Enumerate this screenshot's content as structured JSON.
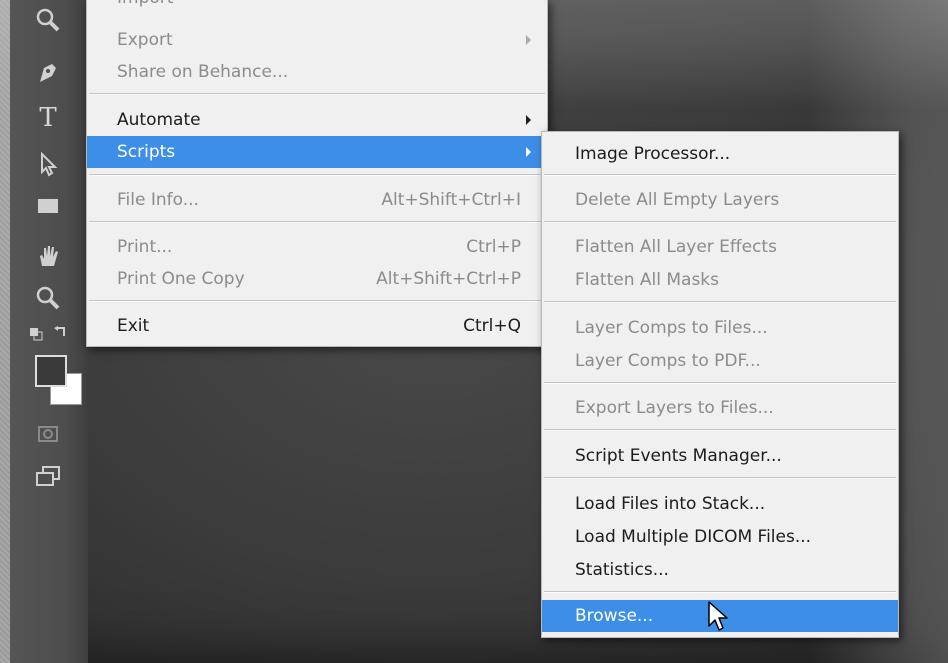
{
  "file_menu": {
    "items": [
      {
        "label": "Import",
        "disabled": true
      },
      {
        "label": "Export",
        "disabled": true
      },
      {
        "label": "Share on Behance...",
        "disabled": true
      },
      {
        "label": "Automate"
      },
      {
        "label": "Scripts",
        "highlighted": true
      },
      {
        "label": "File Info...",
        "shortcut": "Alt+Shift+Ctrl+I",
        "disabled": true
      },
      {
        "label": "Print...",
        "shortcut": "Ctrl+P",
        "disabled": true
      },
      {
        "label": "Print One Copy",
        "shortcut": "Alt+Shift+Ctrl+P",
        "disabled": true
      },
      {
        "label": "Exit",
        "shortcut": "Ctrl+Q"
      }
    ]
  },
  "scripts_menu": {
    "items": [
      {
        "label": "Image Processor..."
      },
      {
        "label": "Delete All Empty Layers",
        "disabled": true
      },
      {
        "label": "Flatten All Layer Effects",
        "disabled": true
      },
      {
        "label": "Flatten All Masks",
        "disabled": true
      },
      {
        "label": "Layer Comps to Files...",
        "disabled": true
      },
      {
        "label": "Layer Comps to PDF...",
        "disabled": true
      },
      {
        "label": "Export Layers to Files...",
        "disabled": true
      },
      {
        "label": "Script Events Manager..."
      },
      {
        "label": "Load Files into Stack..."
      },
      {
        "label": "Load Multiple DICOM Files..."
      },
      {
        "label": "Statistics..."
      },
      {
        "label": "Browse...",
        "highlighted": true
      }
    ]
  },
  "toolbar": {
    "tools": [
      "zoom-icon",
      "pen-icon",
      "type-icon",
      "path-select-icon",
      "rectangle-icon",
      "hand-icon",
      "zoom-icon",
      "swap-colors-icon",
      "quick-mask-icon",
      "screen-mode-icon"
    ]
  }
}
